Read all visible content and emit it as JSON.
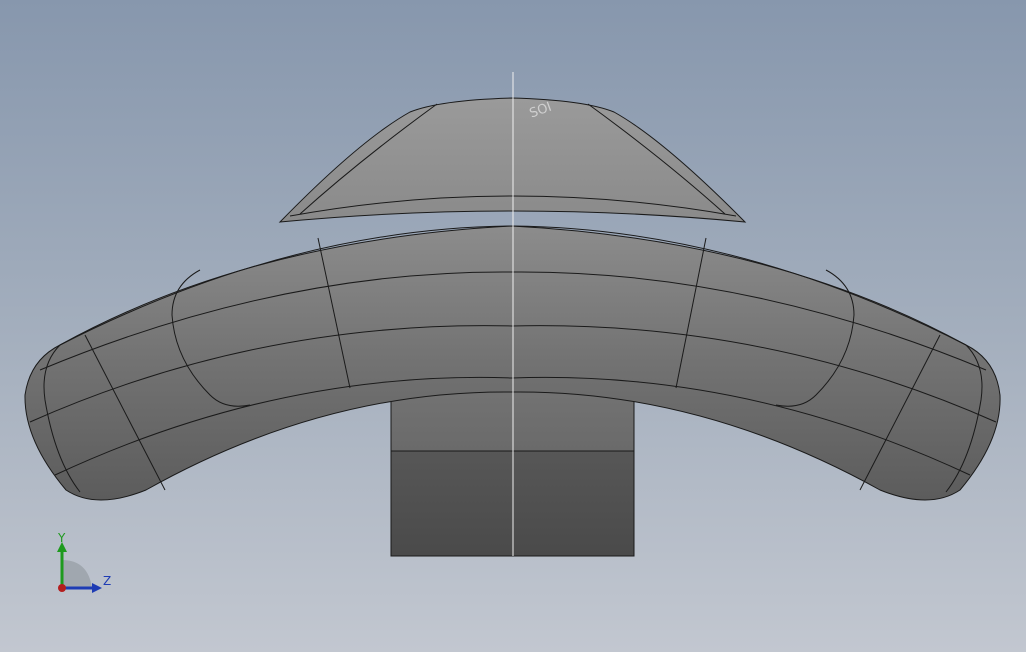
{
  "viewport": {
    "background_top": "#8797ad",
    "background_bottom": "#c2c7d0"
  },
  "model": {
    "engraving_text": "SOI",
    "surface_color": "#7a7a7a",
    "edge_color": "#1a1a1a",
    "centerline_color": "#f0f0f0"
  },
  "triad": {
    "y_label": "Y",
    "z_label": "Z",
    "y_color": "#1e9a1e",
    "z_color": "#1e3cb4",
    "x_color": "#b41e1e"
  }
}
